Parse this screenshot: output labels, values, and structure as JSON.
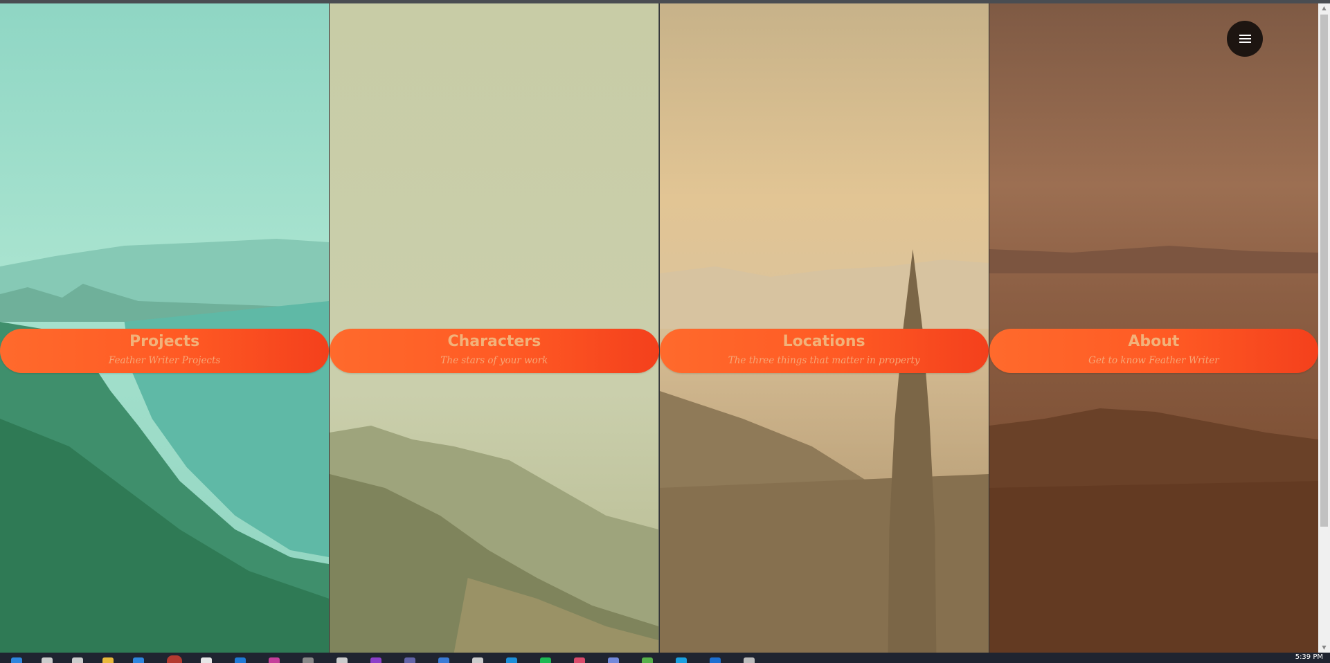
{
  "menu": {
    "icon": "hamburger-menu-icon"
  },
  "panels": [
    {
      "title": "Projects",
      "subtitle": "Feather Writer Projects",
      "tint": "#8fd9c3"
    },
    {
      "title": "Characters",
      "subtitle": "The stars of your work",
      "tint": "#c9cca6"
    },
    {
      "title": "Locations",
      "subtitle": "The three things that matter in property",
      "tint": "#dcbb8a"
    },
    {
      "title": "About",
      "subtitle": "Get to know Feather Writer",
      "tint": "#8a5a3e"
    }
  ],
  "taskbar": {
    "time": "5:39 PM",
    "icons": [
      "start-icon",
      "search-icon",
      "task-view-icon",
      "file-explorer-icon",
      "store-icon",
      "chrome-icon",
      "mail-icon",
      "vscode-icon",
      "photoshop-icon",
      "app-icon",
      "app-icon",
      "podcast-icon",
      "teams-icon",
      "app-icon",
      "app-icon",
      "outlook-icon",
      "spotify-icon",
      "app-icon",
      "discord-icon",
      "app-icon",
      "skype-icon",
      "app-icon",
      "app-icon"
    ]
  }
}
